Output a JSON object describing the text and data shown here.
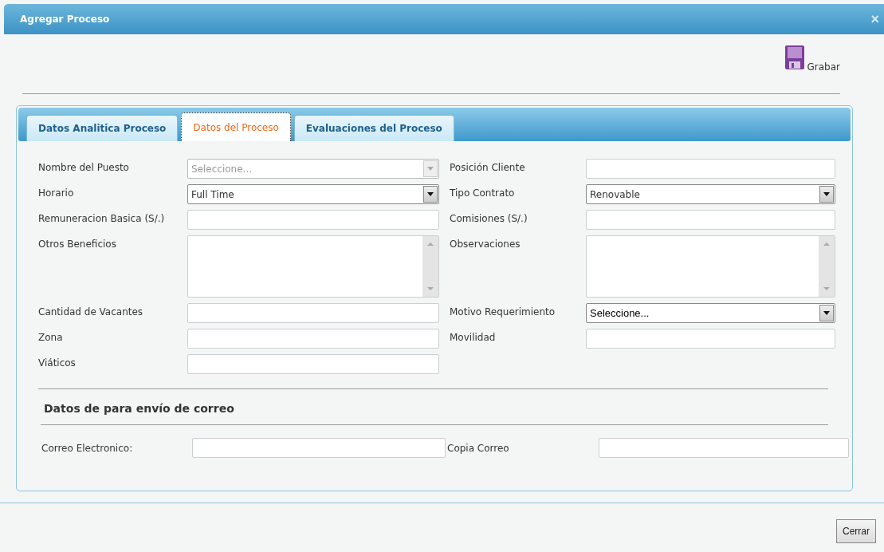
{
  "window": {
    "title": "Agregar Proceso",
    "close": "×"
  },
  "toolbar": {
    "save_label": "Grabar"
  },
  "tabs": [
    {
      "label": "Datos Analitica Proceso",
      "selected": false
    },
    {
      "label": "Datos del Proceso",
      "selected": true
    },
    {
      "label": "Evaluaciones del Proceso",
      "selected": false
    }
  ],
  "form_rows": [
    [
      {
        "label": "Nombre del Puesto",
        "kind": "select",
        "placeholder": "Seleccione...",
        "disabled": true
      },
      {
        "label": "Posición Cliente",
        "kind": "text"
      }
    ],
    [
      {
        "label": "Horario",
        "kind": "select",
        "value": "Full Time",
        "disabled": false
      },
      {
        "label": "Tipo Contrato",
        "kind": "select",
        "value": "Renovable",
        "disabled": false
      }
    ],
    [
      {
        "label": "Remuneracion Basica (S/.)",
        "kind": "text"
      },
      {
        "label": "Comisiones (S/.)",
        "kind": "text"
      }
    ],
    [
      {
        "label": "Otros Beneficios",
        "kind": "textarea"
      },
      {
        "label": "Observaciones",
        "kind": "textarea"
      }
    ],
    [
      {
        "label": "Cantidad de Vacantes",
        "kind": "text"
      },
      {
        "label": "Motivo Requerimiento",
        "kind": "select",
        "value": "Seleccione...",
        "disabled": false
      }
    ],
    [
      {
        "label": "Zona",
        "kind": "text"
      },
      {
        "label": "Movilidad",
        "kind": "text"
      }
    ],
    [
      {
        "label": "Viáticos",
        "kind": "text"
      }
    ]
  ],
  "mail_section": {
    "title": "Datos de para envío de correo",
    "fields": [
      {
        "label": "Correo Electronico:",
        "kind": "text"
      },
      {
        "label": "Copia Correo",
        "kind": "text"
      }
    ]
  },
  "footer": {
    "close_button": "Cerrar"
  }
}
